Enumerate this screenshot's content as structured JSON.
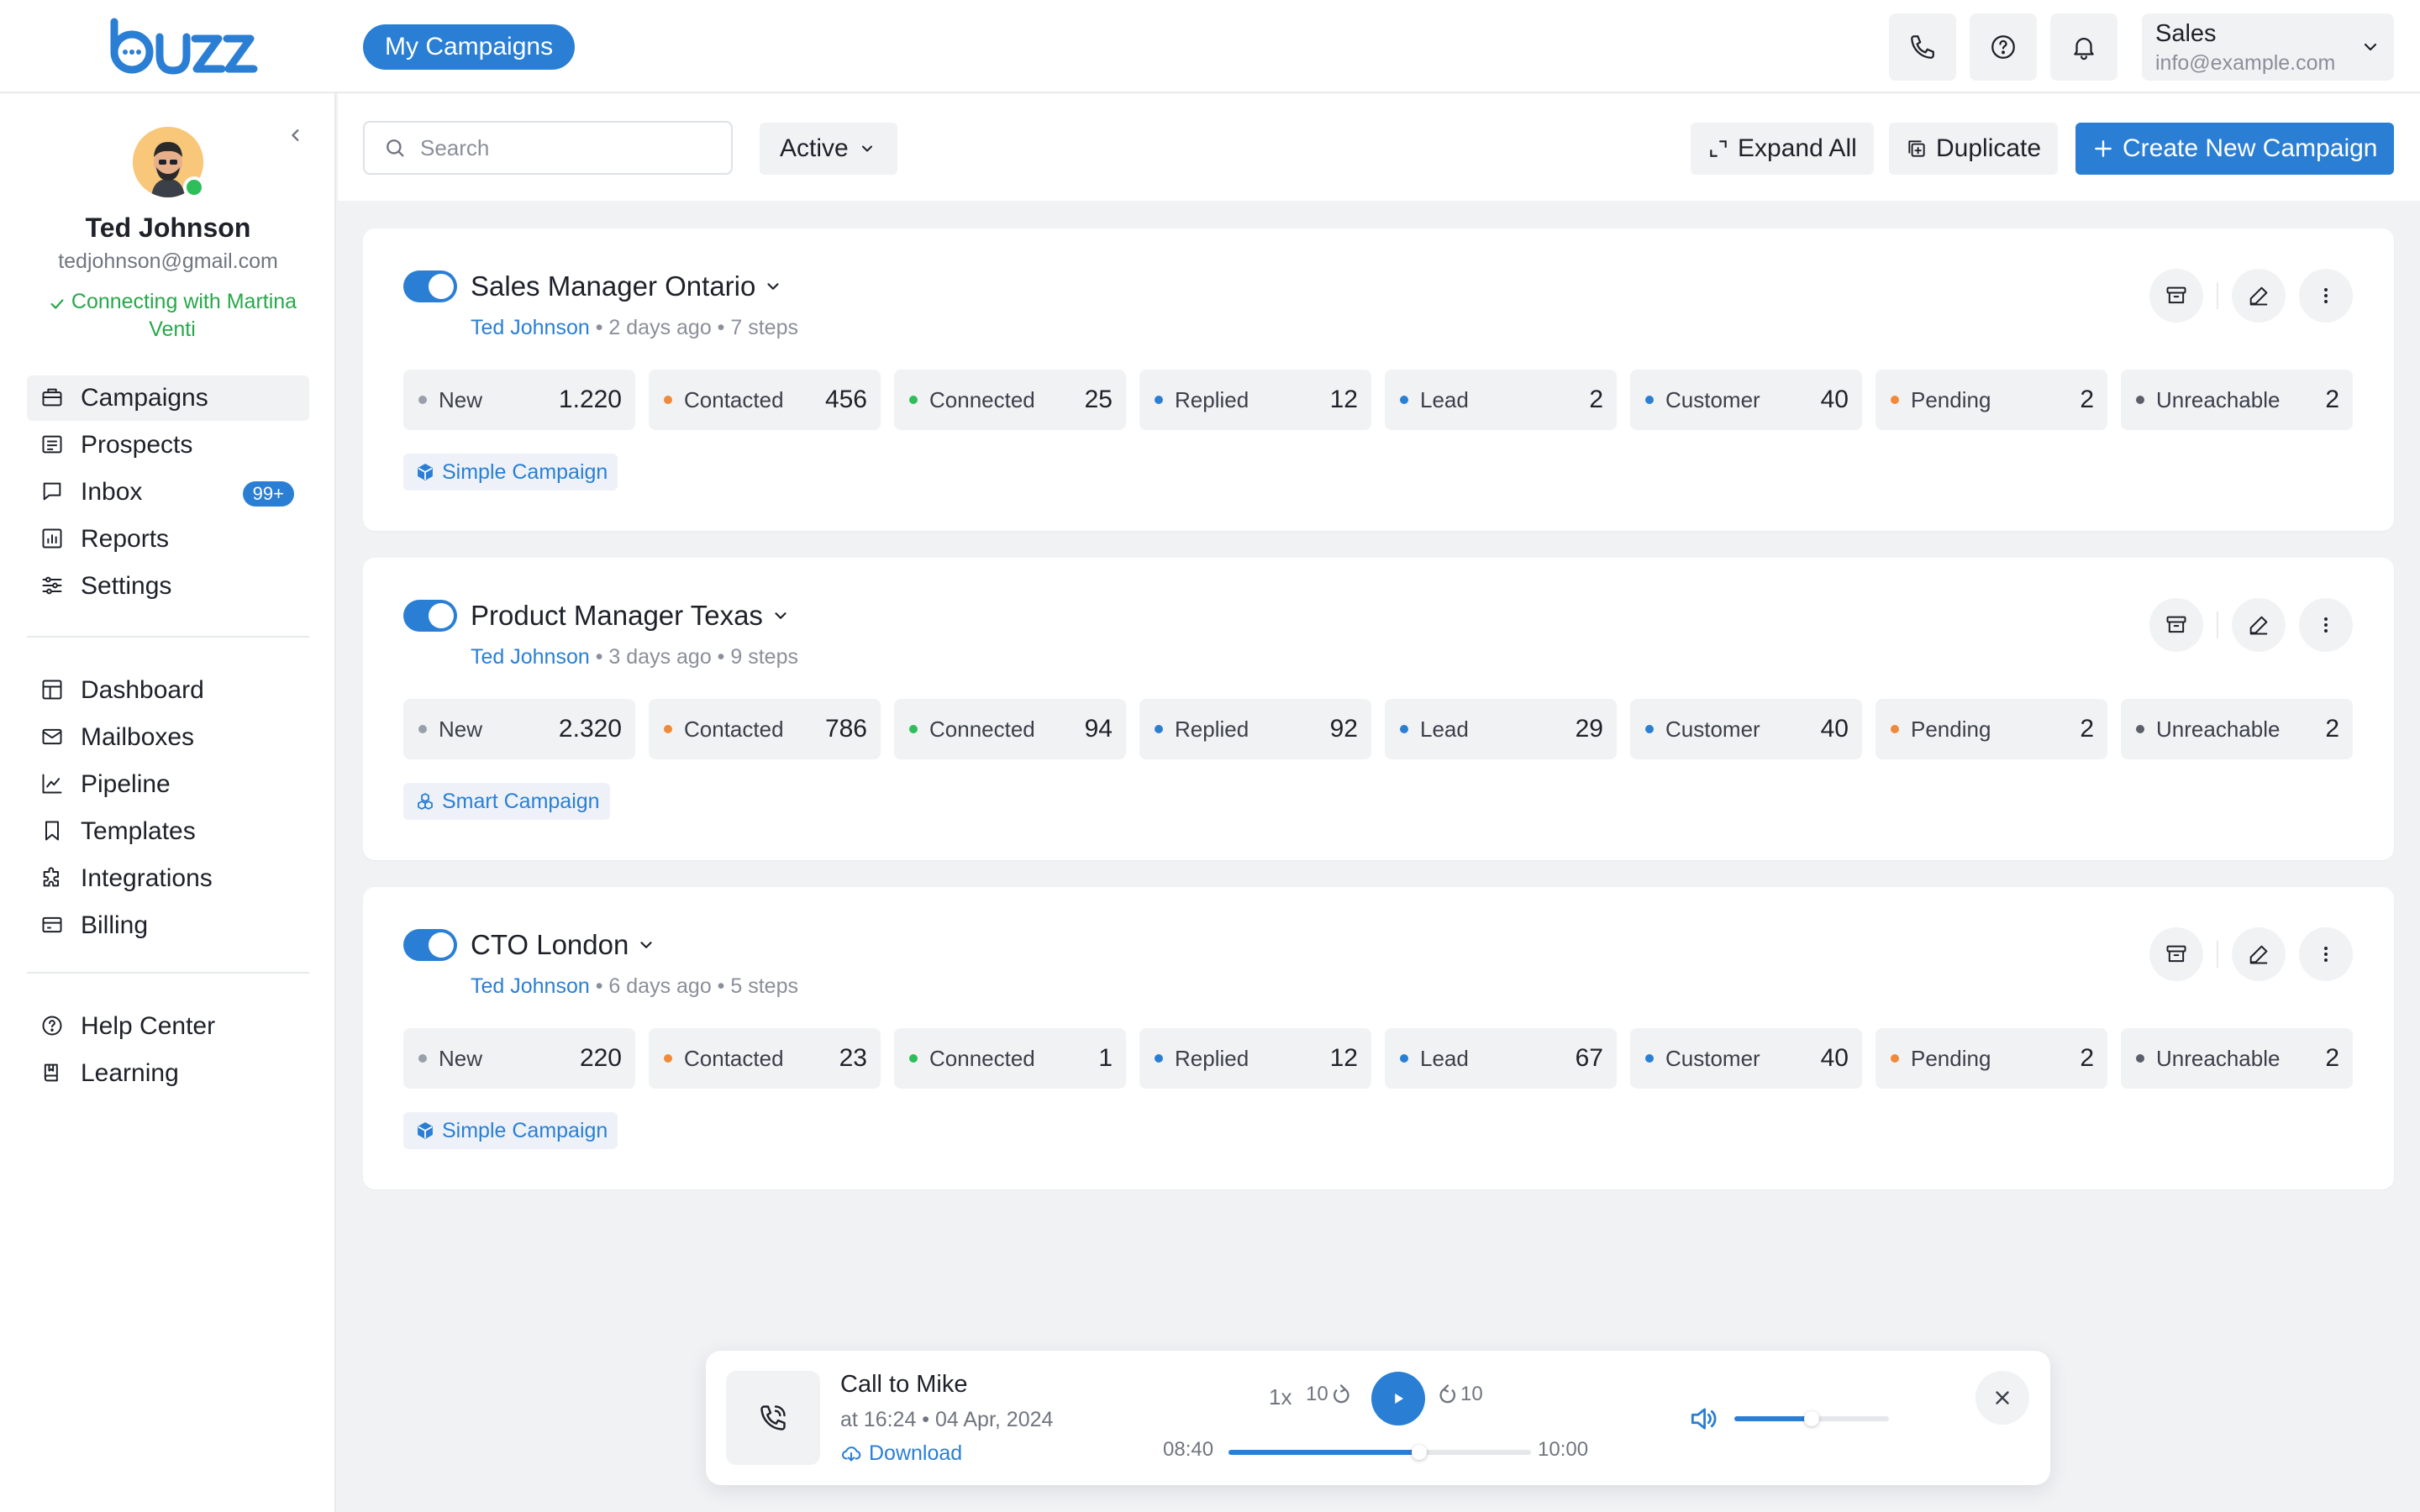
{
  "header": {
    "logo_text": "buzz",
    "active_pill": "My Campaigns",
    "account": {
      "name": "Sales",
      "email": "info@example.com"
    }
  },
  "user": {
    "name": "Ted Johnson",
    "email": "tedjohnson@gmail.com",
    "status": "Connecting with Martina Venti"
  },
  "sidebar": {
    "main": [
      {
        "label": "Campaigns",
        "icon": "briefcase-icon",
        "active": true
      },
      {
        "label": "Prospects",
        "icon": "list-icon"
      },
      {
        "label": "Inbox",
        "icon": "chat-icon",
        "badge": "99+"
      },
      {
        "label": "Reports",
        "icon": "bar-chart-icon"
      },
      {
        "label": "Settings",
        "icon": "sliders-icon"
      }
    ],
    "secondary": [
      {
        "label": "Dashboard",
        "icon": "layout-icon"
      },
      {
        "label": "Mailboxes",
        "icon": "mail-icon"
      },
      {
        "label": "Pipeline",
        "icon": "line-chart-icon"
      },
      {
        "label": "Templates",
        "icon": "bookmark-icon"
      },
      {
        "label": "Integrations",
        "icon": "puzzle-icon"
      },
      {
        "label": "Billing",
        "icon": "credit-card-icon"
      }
    ],
    "help": [
      {
        "label": "Help Center",
        "icon": "help-circle-icon"
      },
      {
        "label": "Learning",
        "icon": "book-icon"
      }
    ]
  },
  "toolbar": {
    "search_placeholder": "Search",
    "filter": "Active",
    "expand_all": "Expand All",
    "duplicate": "Duplicate",
    "create": "Create New Campaign"
  },
  "status_colors": {
    "New": "#9AA0AA",
    "Contacted": "#F08A3A",
    "Connected": "#2DBE5A",
    "Replied": "#2A7FD4",
    "Lead": "#2A7FD4",
    "Customer": "#2A7FD4",
    "Pending": "#F08A3A",
    "Unreachable": "#5A5F69"
  },
  "campaigns": [
    {
      "title": "Sales Manager Ontario",
      "author": "Ted Johnson",
      "meta": " • 2 days ago • 7 steps",
      "enabled": true,
      "stats": [
        {
          "label": "New",
          "value": "1.220"
        },
        {
          "label": "Contacted",
          "value": "456"
        },
        {
          "label": "Connected",
          "value": "25"
        },
        {
          "label": "Replied",
          "value": "12"
        },
        {
          "label": "Lead",
          "value": "2"
        },
        {
          "label": "Customer",
          "value": "40"
        },
        {
          "label": "Pending",
          "value": "2"
        },
        {
          "label": "Unreachable",
          "value": "2"
        }
      ],
      "tag": "Simple Campaign",
      "tag_icon": "cube-icon"
    },
    {
      "title": "Product Manager Texas",
      "author": "Ted Johnson",
      "meta": " • 3 days ago • 9 steps",
      "enabled": true,
      "stats": [
        {
          "label": "New",
          "value": "2.320"
        },
        {
          "label": "Contacted",
          "value": "786"
        },
        {
          "label": "Connected",
          "value": "94"
        },
        {
          "label": "Replied",
          "value": "92"
        },
        {
          "label": "Lead",
          "value": "29"
        },
        {
          "label": "Customer",
          "value": "40"
        },
        {
          "label": "Pending",
          "value": "2"
        },
        {
          "label": "Unreachable",
          "value": "2"
        }
      ],
      "tag": "Smart Campaign",
      "tag_icon": "cubes-icon"
    },
    {
      "title": "CTO London",
      "author": "Ted Johnson",
      "meta": " • 6 days ago • 5 steps",
      "enabled": true,
      "stats": [
        {
          "label": "New",
          "value": "220"
        },
        {
          "label": "Contacted",
          "value": "23"
        },
        {
          "label": "Connected",
          "value": "1"
        },
        {
          "label": "Replied",
          "value": "12"
        },
        {
          "label": "Lead",
          "value": "67"
        },
        {
          "label": "Customer",
          "value": "40"
        },
        {
          "label": "Pending",
          "value": "2"
        },
        {
          "label": "Unreachable",
          "value": "2"
        }
      ],
      "tag": "Simple Campaign",
      "tag_icon": "cube-icon"
    }
  ],
  "player": {
    "title": "Call to Mike",
    "date": "at 16:24 • 04 Apr, 2024",
    "download": "Download",
    "speed": "1x",
    "skip_back": "10",
    "skip_forward": "10",
    "current_time": "08:40",
    "total_time": "10:00",
    "progress": 0.63,
    "volume": 0.5
  }
}
